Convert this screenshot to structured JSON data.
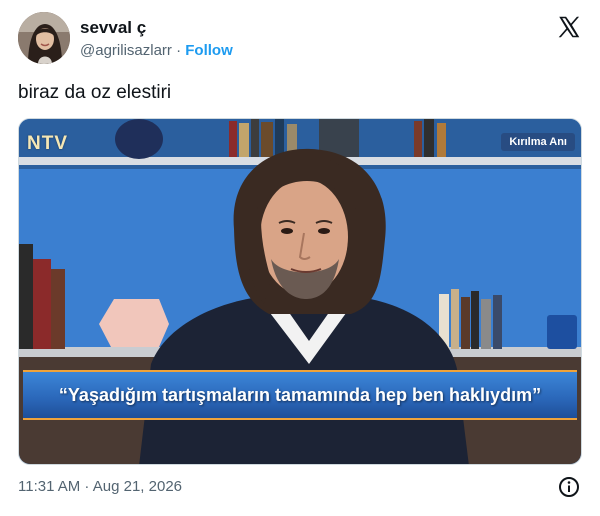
{
  "author": {
    "display_name": "sevval ç",
    "handle": "@agrilisazlarr",
    "separator": "·",
    "follow_label": "Follow"
  },
  "tweet": {
    "text": "biraz da oz elestiri",
    "timestamp": "11:31 AM · Aug 21, 2026"
  },
  "media": {
    "channel_logo": "NTV",
    "segment_badge": "Kırılma Anı",
    "caption": "“Yaşadığım tartışmaların tamamında hep ben haklıydım”"
  },
  "icons": {
    "brand": "x-logo-icon",
    "info": "info-icon",
    "avatar": "avatar"
  },
  "colors": {
    "link": "#1d9bf0",
    "text": "#0f1419",
    "secondary": "#536471",
    "caption_bar": "#2a66b8",
    "caption_border": "#f0a33a"
  }
}
